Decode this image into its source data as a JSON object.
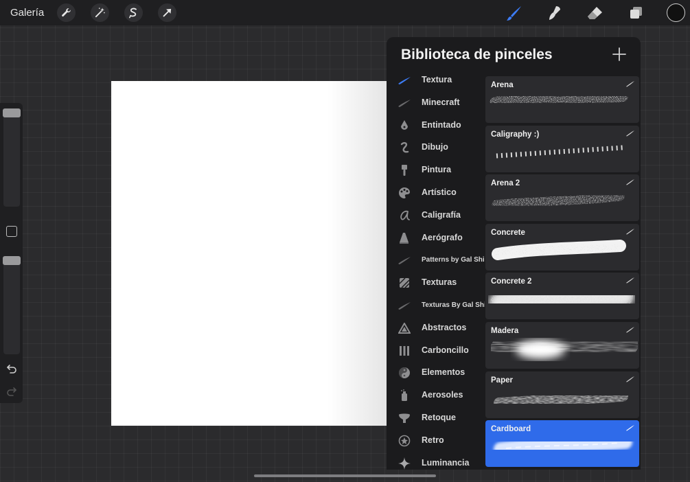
{
  "topbar": {
    "gallery_label": "Galería",
    "tools_left": [
      "wrench-icon",
      "magic-wand-icon",
      "selection-icon",
      "transform-arrow-icon"
    ],
    "tools_right": [
      "brush-icon",
      "smudge-icon",
      "eraser-icon",
      "layers-icon"
    ],
    "active_tool_color": "#3d7cf5"
  },
  "library": {
    "title": "Biblioteca de pinceles",
    "categories": [
      {
        "label": "Textura",
        "icon": "brush-stroke-icon",
        "active": true
      },
      {
        "label": "Minecraft",
        "icon": "brush-stroke-icon"
      },
      {
        "label": "Entintado",
        "icon": "ink-drop-icon"
      },
      {
        "label": "Dibujo",
        "icon": "pencil-squiggle-icon"
      },
      {
        "label": "Pintura",
        "icon": "paint-brush-icon"
      },
      {
        "label": "Artístico",
        "icon": "palette-icon"
      },
      {
        "label": "Caligrafía",
        "icon": "calligraphy-icon"
      },
      {
        "label": "Aerógrafo",
        "icon": "airbrush-icon"
      },
      {
        "label": "Patterns by Gal Shir",
        "icon": "brush-stroke-icon"
      },
      {
        "label": "Texturas",
        "icon": "texture-pattern-icon"
      },
      {
        "label": "Texturas By Gal Shir",
        "icon": "brush-stroke-icon"
      },
      {
        "label": "Abstractos",
        "icon": "triangle-icon"
      },
      {
        "label": "Carboncillo",
        "icon": "charcoal-icon"
      },
      {
        "label": "Elementos",
        "icon": "yin-yang-icon"
      },
      {
        "label": "Aerosoles",
        "icon": "spray-can-icon"
      },
      {
        "label": "Retoque",
        "icon": "retouch-icon"
      },
      {
        "label": "Retro",
        "icon": "star-circle-icon"
      },
      {
        "label": "Luminancia",
        "icon": "sparkle-icon"
      }
    ],
    "brushes": [
      {
        "name": "Arena"
      },
      {
        "name": "Caligraphy :)"
      },
      {
        "name": "Arena 2"
      },
      {
        "name": "Concrete"
      },
      {
        "name": "Concrete 2"
      },
      {
        "name": "Madera"
      },
      {
        "name": "Paper"
      },
      {
        "name": "Cardboard",
        "selected": true
      }
    ],
    "selected_color": "#2f6bea"
  }
}
